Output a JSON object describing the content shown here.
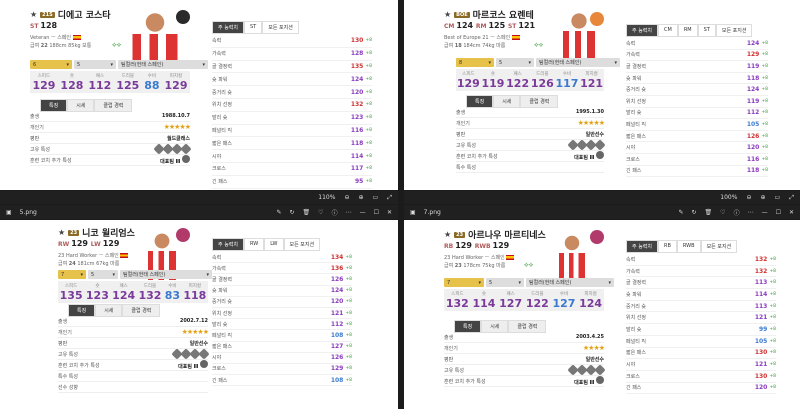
{
  "w1": {
    "name": "디에고 코스타",
    "badge": "21S",
    "pos": "ST",
    "ovr": "128",
    "sub1": "Veteran ㅡ 스페인",
    "sub2": "급여",
    "sub2b": "22",
    "sub2c": "188cm 85kg 보통",
    "sel1": "6",
    "sel2": "5",
    "sel3": "팀컬러(헌태 스페인)",
    "stats": [
      {
        "l": "스피드",
        "v": "129"
      },
      {
        "l": "슛",
        "v": "128"
      },
      {
        "l": "패스",
        "v": "112"
      },
      {
        "l": "드리블",
        "v": "125"
      },
      {
        "l": "수비",
        "v": "88"
      },
      {
        "l": "피지컬",
        "v": "129"
      }
    ],
    "tabs": [
      "특징",
      "시세",
      "클럽 경력"
    ],
    "info": [
      {
        "k": "출생",
        "v": "1988.10.7"
      },
      {
        "k": "개인기",
        "v": ""
      },
      {
        "k": "평판",
        "v": "월드클래스"
      },
      {
        "k": "고유 특성",
        "v": ""
      },
      {
        "k": "훈련 코치 추가 특성",
        "v": "대표팀 Ⅲ"
      }
    ],
    "stars": "★★★★★",
    "rtabs": [
      "주 능력치",
      "ST",
      "모든 포지션"
    ],
    "rows": [
      {
        "k": "속력",
        "v": "130",
        "d": "+8",
        "c": "r"
      },
      {
        "k": "가속력",
        "v": "128",
        "d": "+8",
        "c": "p"
      },
      {
        "k": "골 결정력",
        "v": "135",
        "d": "+8",
        "c": "r"
      },
      {
        "k": "슛 파워",
        "v": "124",
        "d": "+8",
        "c": "p"
      },
      {
        "k": "중거리 슛",
        "v": "120",
        "d": "+8",
        "c": "p"
      },
      {
        "k": "위치 선정",
        "v": "132",
        "d": "+8",
        "c": "r"
      },
      {
        "k": "발리 슛",
        "v": "123",
        "d": "+8",
        "c": "p"
      },
      {
        "k": "페널티 킥",
        "v": "116",
        "d": "+8",
        "c": "p"
      },
      {
        "k": "짧은 패스",
        "v": "118",
        "d": "+8",
        "c": "p"
      },
      {
        "k": "시야",
        "v": "114",
        "d": "+8",
        "c": "p"
      },
      {
        "k": "크로스",
        "v": "117",
        "d": "+8",
        "c": "p"
      },
      {
        "k": "긴 패스",
        "v": "95",
        "d": "+8",
        "c": "p"
      }
    ]
  },
  "w2": {
    "name": "마르코스 요렌테",
    "badge": "BOE",
    "pos": "CM",
    "ovr": "124",
    "pos2": "RM",
    "ovr2": "125",
    "pos3": "ST",
    "ovr3": "121",
    "sub1": "Best of Europe 21 ㅡ 스페인",
    "sub2": "급여",
    "sub2b": "18",
    "sub2c": "184cm 74kg 마름",
    "sel1": "8",
    "sel2": "5",
    "sel3": "팀컬러(헌태 스페인)",
    "stats": [
      {
        "l": "스피드",
        "v": "129"
      },
      {
        "l": "슛",
        "v": "119"
      },
      {
        "l": "패스",
        "v": "122"
      },
      {
        "l": "드리블",
        "v": "126"
      },
      {
        "l": "수비",
        "v": "117"
      },
      {
        "l": "피지컬",
        "v": "121"
      }
    ],
    "tabs": [
      "특징",
      "시세",
      "클럽 경력"
    ],
    "info": [
      {
        "k": "출생",
        "v": "1995.1.30"
      },
      {
        "k": "개인기",
        "v": ""
      },
      {
        "k": "평판",
        "v": "일반선수"
      },
      {
        "k": "고유 특성",
        "v": ""
      },
      {
        "k": "훈련 코치 추가 특성",
        "v": "대표팀 Ⅲ"
      },
      {
        "k": "특수 특성",
        "v": ""
      }
    ],
    "stars": "★★★★★",
    "rtabs": [
      "주 능력치",
      "CM",
      "RM",
      "ST",
      "모든 포지션"
    ],
    "rows": [
      {
        "k": "속력",
        "v": "124",
        "d": "+8",
        "c": "p"
      },
      {
        "k": "가속력",
        "v": "129",
        "d": "+8",
        "c": "r"
      },
      {
        "k": "골 결정력",
        "v": "119",
        "d": "+8",
        "c": "p"
      },
      {
        "k": "슛 파워",
        "v": "118",
        "d": "+8",
        "c": "p"
      },
      {
        "k": "중거리 슛",
        "v": "124",
        "d": "+8",
        "c": "p"
      },
      {
        "k": "위치 선정",
        "v": "119",
        "d": "+8",
        "c": "p"
      },
      {
        "k": "발리 슛",
        "v": "112",
        "d": "+8",
        "c": "p"
      },
      {
        "k": "페널티 킥",
        "v": "105",
        "d": "+8",
        "c": "b"
      },
      {
        "k": "짧은 패스",
        "v": "126",
        "d": "+8",
        "c": "r"
      },
      {
        "k": "시야",
        "v": "120",
        "d": "+8",
        "c": "p"
      },
      {
        "k": "크로스",
        "v": "116",
        "d": "+8",
        "c": "p"
      },
      {
        "k": "긴 패스",
        "v": "118",
        "d": "+8",
        "c": "p"
      }
    ]
  },
  "w3": {
    "name": "니코 윌리엄스",
    "badge": "23",
    "pos": "RW",
    "ovr": "129",
    "pos2": "LW",
    "ovr2": "129",
    "sub1": "23 Hard Worker ㅡ 스페인",
    "sub2": "급여",
    "sub2b": "24",
    "sub2c": "181cm 67kg 마름",
    "sel1": "7",
    "sel2": "5",
    "sel3": "팀컬러(헌태 스페인)",
    "stats": [
      {
        "l": "스피드",
        "v": "135"
      },
      {
        "l": "슛",
        "v": "123"
      },
      {
        "l": "패스",
        "v": "124"
      },
      {
        "l": "드리블",
        "v": "132"
      },
      {
        "l": "수비",
        "v": "83"
      },
      {
        "l": "피지컬",
        "v": "118"
      }
    ],
    "tabs": [
      "특징",
      "시세",
      "클럽 경력"
    ],
    "info": [
      {
        "k": "출생",
        "v": "2002.7.12"
      },
      {
        "k": "개인기",
        "v": ""
      },
      {
        "k": "평판",
        "v": "일반선수"
      },
      {
        "k": "고유 특성",
        "v": ""
      },
      {
        "k": "훈련 코치 추가 특성",
        "v": "대표팀 Ⅲ"
      },
      {
        "k": "특수 특성",
        "v": ""
      },
      {
        "k": "선수 성향",
        "v": ""
      }
    ],
    "stars": "★★★★★",
    "rtabs": [
      "주 능력치",
      "RW",
      "LW",
      "모든 포지션"
    ],
    "rows": [
      {
        "k": "속력",
        "v": "134",
        "d": "+8",
        "c": "r"
      },
      {
        "k": "가속력",
        "v": "136",
        "d": "+8",
        "c": "r"
      },
      {
        "k": "골 결정력",
        "v": "126",
        "d": "+8",
        "c": "p"
      },
      {
        "k": "슛 파워",
        "v": "124",
        "d": "+8",
        "c": "p"
      },
      {
        "k": "중거리 슛",
        "v": "120",
        "d": "+8",
        "c": "p"
      },
      {
        "k": "위치 선정",
        "v": "121",
        "d": "+8",
        "c": "p"
      },
      {
        "k": "발리 슛",
        "v": "112",
        "d": "+8",
        "c": "p"
      },
      {
        "k": "페널티 킥",
        "v": "108",
        "d": "+8",
        "c": "b"
      },
      {
        "k": "짧은 패스",
        "v": "127",
        "d": "+8",
        "c": "p"
      },
      {
        "k": "시야",
        "v": "126",
        "d": "+8",
        "c": "p"
      },
      {
        "k": "크로스",
        "v": "129",
        "d": "+8",
        "c": "p"
      },
      {
        "k": "긴 패스",
        "v": "108",
        "d": "+8",
        "c": "b"
      }
    ]
  },
  "w4": {
    "name": "아르나우 마르티네스",
    "badge": "23",
    "pos": "RB",
    "ovr": "129",
    "pos2": "RWB",
    "ovr2": "129",
    "sub1": "23 Hard Worker ㅡ 스페인",
    "sub2": "급여",
    "sub2b": "23",
    "sub2c": "178cm 75kg 마름",
    "sel1": "7",
    "sel2": "5",
    "sel3": "팀컬러(헌태 스페인)",
    "stats": [
      {
        "l": "스피드",
        "v": "132"
      },
      {
        "l": "슛",
        "v": "114"
      },
      {
        "l": "패스",
        "v": "127"
      },
      {
        "l": "드리블",
        "v": "122"
      },
      {
        "l": "수비",
        "v": "127"
      },
      {
        "l": "피지컬",
        "v": "124"
      }
    ],
    "tabs": [
      "특징",
      "시세",
      "클럽 경력"
    ],
    "info": [
      {
        "k": "출생",
        "v": "2003.4.25"
      },
      {
        "k": "개인기",
        "v": ""
      },
      {
        "k": "평판",
        "v": "일반선수"
      },
      {
        "k": "고유 특성",
        "v": ""
      },
      {
        "k": "훈련 코치 추가 특성",
        "v": "대표팀 Ⅲ"
      }
    ],
    "stars": "★★★★",
    "rtabs": [
      "주 능력치",
      "RB",
      "RWB",
      "모든 포지션"
    ],
    "rows": [
      {
        "k": "속력",
        "v": "132",
        "d": "+8",
        "c": "r"
      },
      {
        "k": "가속력",
        "v": "132",
        "d": "+8",
        "c": "r"
      },
      {
        "k": "골 결정력",
        "v": "113",
        "d": "+8",
        "c": "p"
      },
      {
        "k": "슛 파워",
        "v": "114",
        "d": "+8",
        "c": "p"
      },
      {
        "k": "중거리 슛",
        "v": "113",
        "d": "+8",
        "c": "p"
      },
      {
        "k": "위치 선정",
        "v": "121",
        "d": "+8",
        "c": "p"
      },
      {
        "k": "발리 슛",
        "v": "99",
        "d": "+8",
        "c": "b"
      },
      {
        "k": "페널티 킥",
        "v": "105",
        "d": "+8",
        "c": "b"
      },
      {
        "k": "짧은 패스",
        "v": "130",
        "d": "+8",
        "c": "r"
      },
      {
        "k": "시야",
        "v": "121",
        "d": "+8",
        "c": "p"
      },
      {
        "k": "크로스",
        "v": "130",
        "d": "+8",
        "c": "r"
      },
      {
        "k": "긴 패스",
        "v": "120",
        "d": "+8",
        "c": "p"
      }
    ]
  },
  "viewer": {
    "zoom1": "110%",
    "zoom2": "100%",
    "file3": "5.png",
    "file4": "7.png"
  }
}
